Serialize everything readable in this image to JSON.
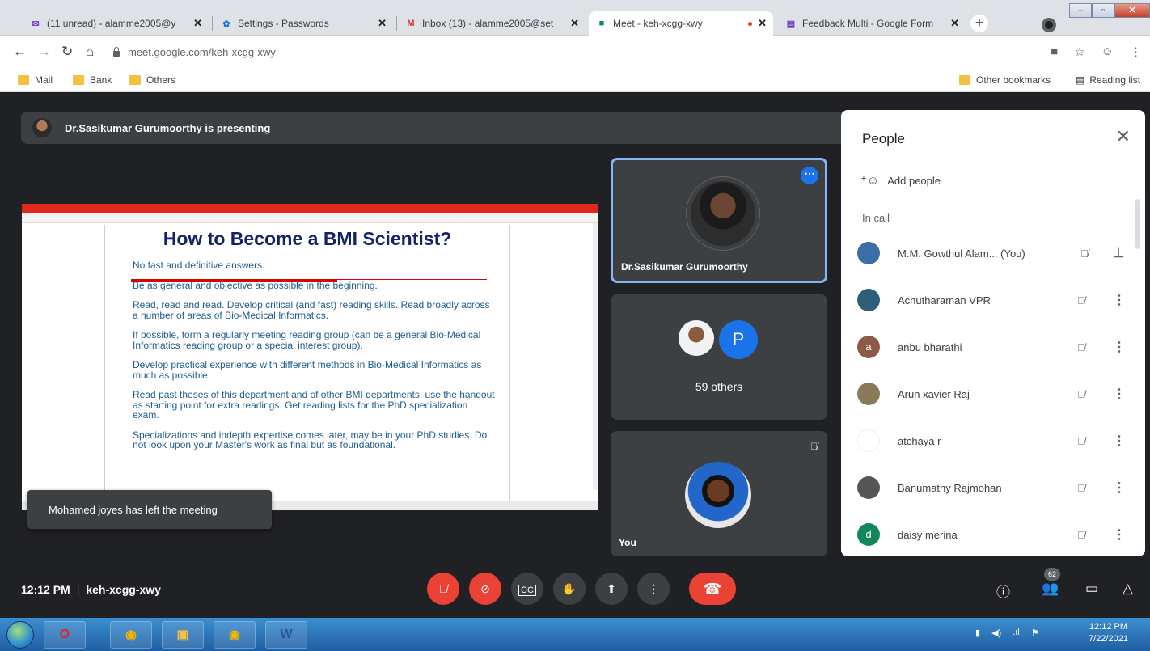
{
  "browser": {
    "tabs": [
      {
        "title": "(11 unread) - alamme2005@y",
        "icon": "gmail-icon",
        "color": "#7a3ec7"
      },
      {
        "title": "Settings - Passwords",
        "icon": "settings-gear-icon",
        "color": "#1a73e8"
      },
      {
        "title": "Inbox (13) - alamme2005@set",
        "icon": "gmail-icon",
        "color": "#d93025"
      },
      {
        "title": "Meet - keh-xcgg-xwy",
        "icon": "meet-icon",
        "color": "#00897b"
      },
      {
        "title": "Feedback Multi - Google Form",
        "icon": "forms-icon",
        "color": "#673ab7"
      }
    ],
    "url": "meet.google.com/keh-xcgg-xwy",
    "bookmarks": [
      "Mail",
      "Bank",
      "Others"
    ],
    "other_bookmarks": "Other bookmarks",
    "reading_list": "Reading list"
  },
  "meet": {
    "presenter_banner": "Dr.Sasikumar Gurumoorthy is presenting",
    "slide": {
      "title": "How to Become a BMI Scientist?",
      "lines": [
        "No fast and definitive answers.",
        "Be as general and objective as possible in the beginning.",
        "Read, read and read. Develop critical (and fast) reading skills. Read broadly across a number of areas of Bio-Medical Informatics.",
        "If possible, form a regularly meeting reading group (can be a general Bio-Medical Informatics reading group or a special interest group).",
        "Develop practical experience with different methods in Bio-Medical Informatics as much as possible.",
        "Read past theses of this department and of other BMI departments; use the handout as starting point for extra readings. Get reading lists for the PhD specialization exam.",
        "Specializations and indepth expertise comes later, may be in your PhD studies. Do not look upon your Master's work as final but as foundational."
      ]
    },
    "toast": "Mohamed joyes has left the meeting",
    "tiles": {
      "presenter_name": "Dr.Sasikumar Gurumoorthy",
      "others_initial": "P",
      "others_label": "59 others",
      "you_label": "You"
    },
    "people_panel": {
      "title": "People",
      "add_people": "Add people",
      "section": "In call",
      "participants": [
        {
          "name": "M.M. Gowthul Alam... (You)",
          "avatar_color": "#3b6ea5",
          "initial": ""
        },
        {
          "name": "Achutharaman VPR",
          "avatar_color": "#2e5e78",
          "initial": ""
        },
        {
          "name": "anbu bharathi",
          "avatar_color": "#8d5a47",
          "initial": "a"
        },
        {
          "name": "Arun xavier Raj",
          "avatar_color": "#8a7a5a",
          "initial": ""
        },
        {
          "name": "atchaya r",
          "avatar_color": "#ffffff",
          "initial": ""
        },
        {
          "name": "Banumathy Rajmohan",
          "avatar_color": "#555555",
          "initial": ""
        },
        {
          "name": "daisy merina",
          "avatar_color": "#12875c",
          "initial": "d"
        }
      ]
    },
    "bottom": {
      "time": "12:12 PM",
      "meeting_code": "keh-xcgg-xwy",
      "people_count": "62"
    }
  },
  "taskbar": {
    "time": "12:12 PM",
    "date": "7/22/2021"
  }
}
